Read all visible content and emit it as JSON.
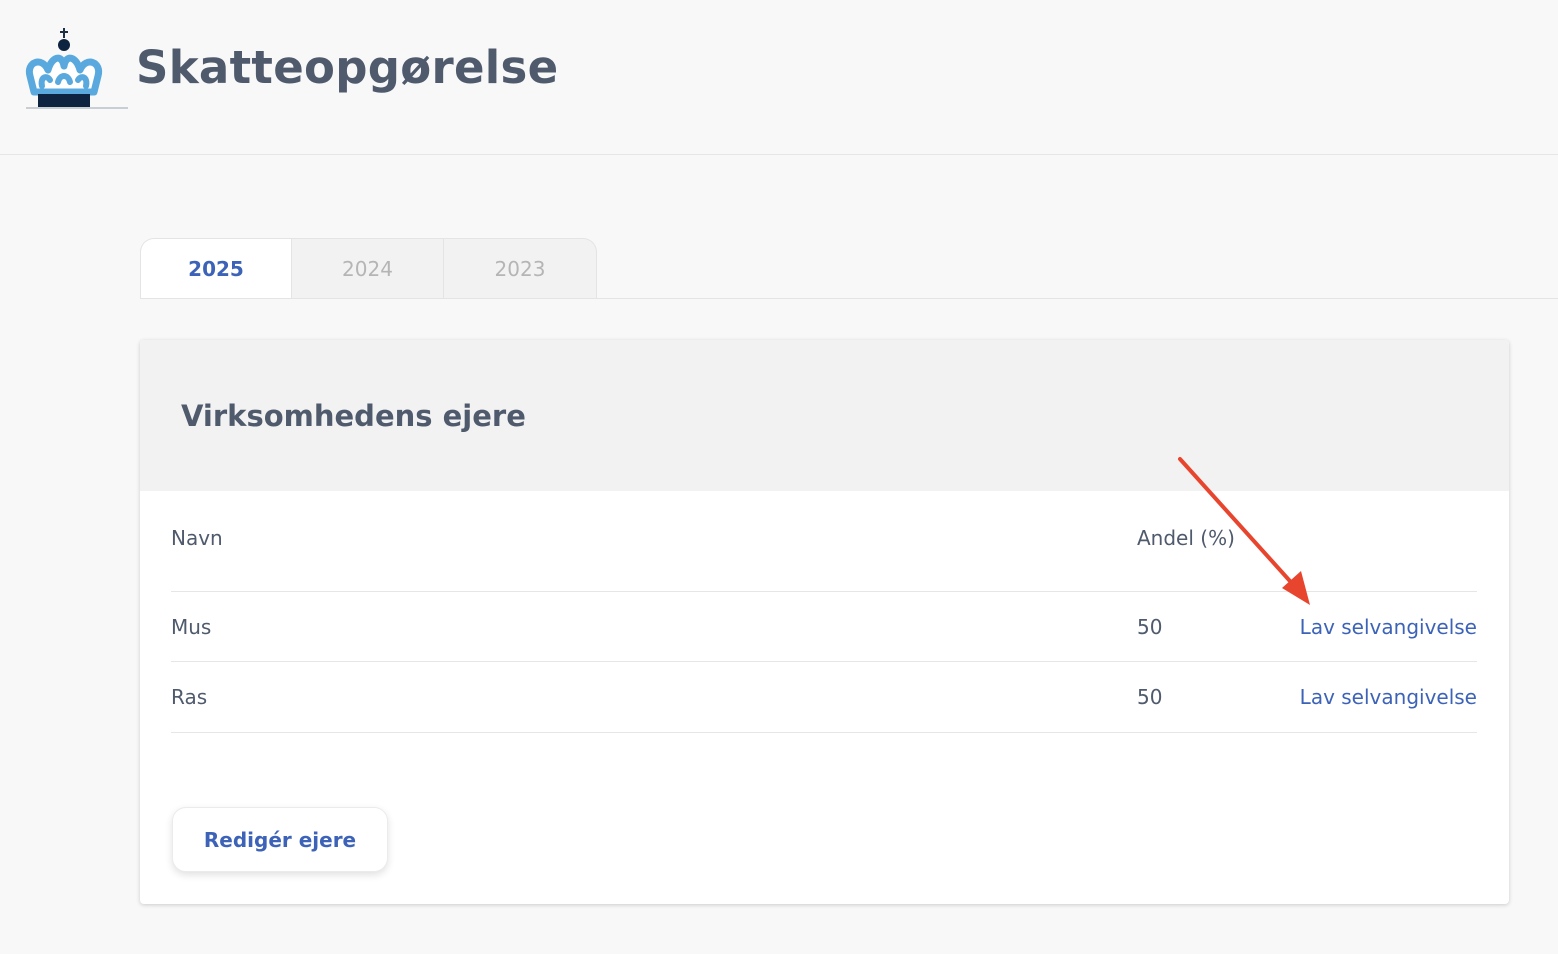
{
  "header": {
    "title": "Skatteopgørelse",
    "logo": "crown-logo"
  },
  "tabs": [
    {
      "label": "2025",
      "active": true
    },
    {
      "label": "2024",
      "active": false
    },
    {
      "label": "2023",
      "active": false
    }
  ],
  "card": {
    "title": "Virksomhedens ejere",
    "columns": {
      "name": "Navn",
      "share": "Andel (%)"
    },
    "rows": [
      {
        "name": "Mus",
        "share": "50",
        "action": "Lav selvangivelse"
      },
      {
        "name": "Ras",
        "share": "50",
        "action": "Lav selvangivelse"
      }
    ],
    "edit_button": "Redigér ejere"
  },
  "annotation": {
    "icon": "red-arrow",
    "color": "#e8452f"
  },
  "colors": {
    "accent": "#3d63b8",
    "title": "#4f5a6d",
    "crown": "#5aa9de",
    "crown_base": "#0d2340"
  }
}
